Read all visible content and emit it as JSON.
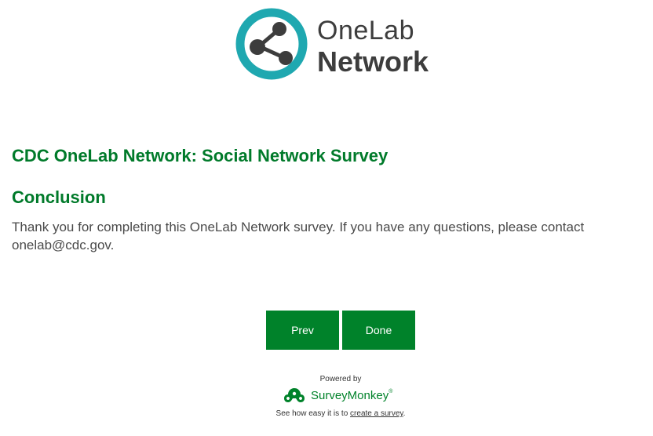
{
  "logo": {
    "line1": "OneLab",
    "line2": "Network",
    "colors": {
      "ring": "#1fa8b0",
      "text": "#3d3d3d"
    },
    "icon": "share-network-icon"
  },
  "survey": {
    "title": "CDC OneLab Network: Social Network Survey",
    "section_title": "Conclusion",
    "message": "Thank you for completing this OneLab Network survey. If you have any questions, please contact onelab@cdc.gov.",
    "accent_color": "#007a2a"
  },
  "buttons": {
    "prev_label": "Prev",
    "done_label": "Done",
    "color": "#00822a"
  },
  "footer": {
    "powered_by": "Powered by",
    "brand": "SurveyMonkey",
    "brand_tm": "®",
    "brand_icon": "surveymonkey-logo-icon",
    "cta_prefix": "See how easy it is to",
    "cta_link": "create a survey",
    "cta_suffix": "."
  }
}
